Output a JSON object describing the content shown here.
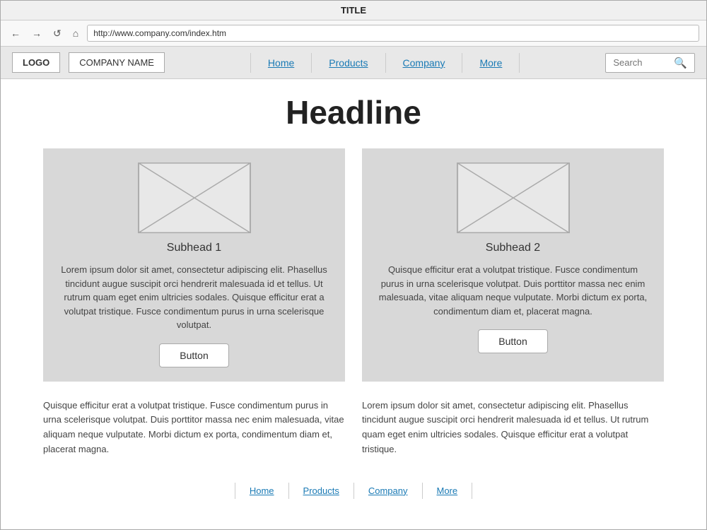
{
  "browser": {
    "title": "TITLE",
    "url": "http://www.company.com/index.htm",
    "nav_back": "←",
    "nav_forward": "→",
    "nav_refresh": "↺",
    "nav_home": "⌂"
  },
  "header": {
    "logo": "LOGO",
    "company_name": "COMPANY NAME",
    "nav": [
      {
        "label": "Home",
        "id": "home"
      },
      {
        "label": "Products",
        "id": "products"
      },
      {
        "label": "Company",
        "id": "company"
      },
      {
        "label": "More",
        "id": "more"
      }
    ],
    "search_placeholder": "Search"
  },
  "page": {
    "headline": "Headline",
    "cards": [
      {
        "subhead": "Subhead 1",
        "text": "Lorem ipsum dolor sit amet, consectetur adipiscing elit. Phasellus tincidunt augue suscipit orci hendrerit malesuada id et tellus. Ut rutrum quam eget enim ultricies sodales. Quisque efficitur erat a volutpat tristique. Fusce condimentum purus in urna scelerisque volutpat.",
        "button": "Button"
      },
      {
        "subhead": "Subhead 2",
        "text": "Quisque efficitur erat a volutpat tristique. Fusce condimentum purus in urna scelerisque volutpat. Duis porttitor massa nec enim malesuada, vitae aliquam neque vulputate. Morbi dictum ex porta, condimentum diam et, placerat magna.",
        "button": "Button"
      }
    ],
    "bottom_texts": [
      "Quisque efficitur erat a volutpat tristique. Fusce condimentum purus in urna scelerisque volutpat. Duis porttitor massa nec enim malesuada, vitae aliquam neque vulputate. Morbi dictum ex porta, condimentum diam et, placerat magna.",
      "Lorem ipsum dolor sit amet, consectetur adipiscing elit. Phasellus tincidunt augue suscipit orci hendrerit malesuada id et tellus. Ut rutrum quam eget enim ultricies sodales. Quisque efficitur erat a volutpat tristique."
    ],
    "footer_nav": [
      {
        "label": "Home",
        "id": "footer-home"
      },
      {
        "label": "Products",
        "id": "footer-products"
      },
      {
        "label": "Company",
        "id": "footer-company"
      },
      {
        "label": "More",
        "id": "footer-more"
      }
    ]
  }
}
